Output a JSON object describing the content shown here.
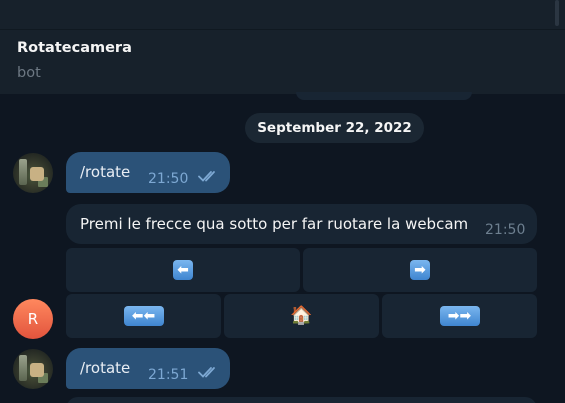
{
  "header": {
    "title": "Rotatecamera",
    "subtitle": "bot"
  },
  "date_separator": "September 22, 2022",
  "messages": [
    {
      "sender": "user",
      "text": "/rotate",
      "time": "21:50",
      "status": "read"
    },
    {
      "sender": "bot",
      "text": "Premi le frecce qua sotto per far ruotare la webcam",
      "time": "21:50"
    },
    {
      "sender": "user",
      "text": "/rotate",
      "time": "21:51",
      "status": "read"
    }
  ],
  "bot_avatar_initial": "R",
  "keyboard": {
    "row1": [
      {
        "icon": "left-arrow-icon",
        "glyph": "⬅"
      },
      {
        "icon": "right-arrow-icon",
        "glyph": "➡"
      }
    ],
    "row2": [
      {
        "icon": "double-left-arrow-icon",
        "glyph": "⬅⬅"
      },
      {
        "icon": "house-icon",
        "glyph": "🏠"
      },
      {
        "icon": "double-right-arrow-icon",
        "glyph": "➡➡"
      }
    ]
  },
  "colors": {
    "background": "#0e1621",
    "header": "#17212b",
    "outgoing_bubble": "#2b5278",
    "incoming_bubble": "#182533",
    "avatar_initial": "#e2543d"
  }
}
